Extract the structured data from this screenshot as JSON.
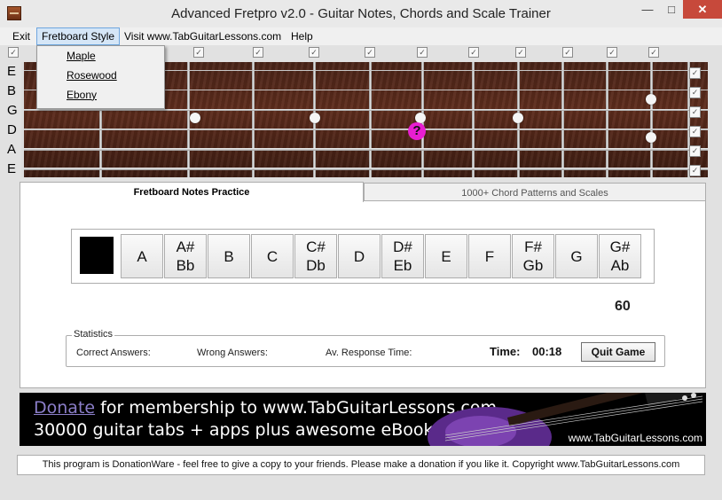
{
  "window": {
    "title": "Advanced Fretpro v2.0 - Guitar Notes, Chords and Scale Trainer",
    "min_glyph": "—",
    "max_glyph": "□",
    "close_glyph": "✕"
  },
  "menu": {
    "items": [
      "Exit",
      "Fretboard Style",
      "Visit www.TabGuitarLessons.com",
      "Help"
    ],
    "active": "Fretboard Style",
    "dropdown": [
      "Maple",
      "Rosewood",
      "Ebony"
    ]
  },
  "fretboard": {
    "strings": [
      "E",
      "B",
      "G",
      "D",
      "A",
      "E"
    ],
    "question_mark": "?",
    "check_glyph": "✓",
    "style": "Rosewood"
  },
  "tabs": [
    "Fretboard Notes Practice",
    "1000+ Chord Patterns and Scales"
  ],
  "notes": [
    {
      "top": "A",
      "bottom": ""
    },
    {
      "top": "A#",
      "bottom": "Bb"
    },
    {
      "top": "B",
      "bottom": ""
    },
    {
      "top": "C",
      "bottom": ""
    },
    {
      "top": "C#",
      "bottom": "Db"
    },
    {
      "top": "D",
      "bottom": ""
    },
    {
      "top": "D#",
      "bottom": "Eb"
    },
    {
      "top": "E",
      "bottom": ""
    },
    {
      "top": "F",
      "bottom": ""
    },
    {
      "top": "F#",
      "bottom": "Gb"
    },
    {
      "top": "G",
      "bottom": ""
    },
    {
      "top": "G#",
      "bottom": "Ab"
    }
  ],
  "counter": "60",
  "stats": {
    "title": "Statistics",
    "correct": "Correct Answers:",
    "wrong": "Wrong Answers:",
    "response": "Av. Response Time:",
    "time_label": "Time:",
    "time_value": "00:18",
    "quit": "Quit Game"
  },
  "banner": {
    "donate": "Donate",
    "line1_rest": " for membership to www.TabGuitarLessons.com",
    "line2": "30000 guitar tabs + apps plus awesome eBook",
    "url": "www.TabGuitarLessons.com"
  },
  "footer": "This program is DonationWare - feel free to give a copy to your friends. Please make a donation if you like it. Copyright www.TabGuitarLessons.com",
  "colors": {
    "question_marker": "#e81ed1",
    "fretboard_wood": "#4a2418",
    "close_button": "#c7493b"
  }
}
